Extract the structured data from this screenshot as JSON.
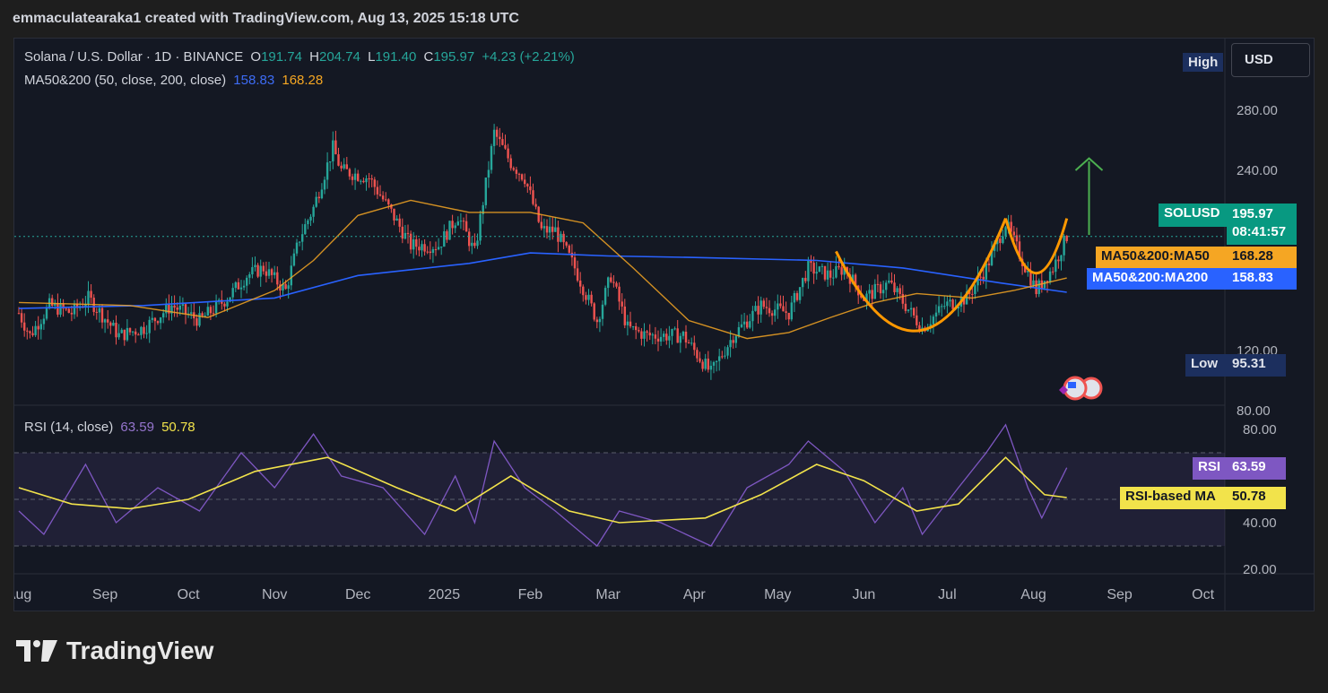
{
  "header": {
    "caption": "emmaculatearaka1 created with TradingView.com, Aug 13, 2025 15:18 UTC"
  },
  "legend": {
    "symbol": "Solana / U.S. Dollar · 1D · BINANCE",
    "o_label": "O",
    "o": "191.74",
    "h_label": "H",
    "h": "204.74",
    "l_label": "L",
    "l": "191.40",
    "c_label": "C",
    "c": "195.97",
    "change": "+4.23 (+2.21%)",
    "ma_label": "MA50&200 (50, close, 200, close)",
    "ma50": "158.83",
    "ma200": "168.28",
    "rsi_label": "RSI (14, close)",
    "rsi": "63.59",
    "rsi_ma": "50.78"
  },
  "badges": {
    "high_label": "High",
    "currency": "USD",
    "sym_label": "SOLUSD",
    "price": "195.97",
    "countdown": "08:41:57",
    "ma50_label": "MA50&200:MA50",
    "ma50_value": "168.28",
    "ma200_label": "MA50&200:MA200",
    "ma200_value": "158.83",
    "low_label": "Low",
    "low_value": "95.31",
    "rsi_label": "RSI",
    "rsi_value": "63.59",
    "rsima_label": "RSI-based MA",
    "rsima_value": "50.78"
  },
  "colors": {
    "up": "#26a69a",
    "down": "#ef5350",
    "ma50": "#f5a623",
    "ma200": "#2962ff",
    "rsi": "#7e57c2",
    "rsi_ma": "#f2e34b",
    "pattern": "#ff9800",
    "arrow": "#4caf50"
  },
  "chart_data": [
    {
      "type": "candlestick",
      "title": "Solana / U.S. Dollar · 1D · BINANCE",
      "x_ticks": [
        "Aug",
        "Sep",
        "Oct",
        "Nov",
        "Dec",
        "2025",
        "Feb",
        "Mar",
        "Apr",
        "May",
        "Jun",
        "Jul",
        "Aug",
        "Sep",
        "Oct"
      ],
      "y_ticks": [
        "80.00",
        "120.00",
        "240.00",
        "280.00"
      ],
      "ylim": [
        75,
        290
      ],
      "close_path": [
        [
          "2024-08-01",
          145
        ],
        [
          "2024-08-05",
          130
        ],
        [
          "2024-08-12",
          150
        ],
        [
          "2024-08-20",
          145
        ],
        [
          "2024-08-26",
          155
        ],
        [
          "2024-09-06",
          130
        ],
        [
          "2024-09-15",
          135
        ],
        [
          "2024-09-25",
          150
        ],
        [
          "2024-10-05",
          140
        ],
        [
          "2024-10-15",
          155
        ],
        [
          "2024-10-22",
          170
        ],
        [
          "2024-10-28",
          175
        ],
        [
          "2024-11-05",
          160
        ],
        [
          "2024-11-10",
          195
        ],
        [
          "2024-11-15",
          215
        ],
        [
          "2024-11-22",
          255
        ],
        [
          "2024-11-25",
          240
        ],
        [
          "2024-12-05",
          235
        ],
        [
          "2024-12-12",
          215
        ],
        [
          "2024-12-20",
          190
        ],
        [
          "2024-12-30",
          190
        ],
        [
          "2025-01-06",
          210
        ],
        [
          "2025-01-12",
          185
        ],
        [
          "2025-01-19",
          265
        ],
        [
          "2025-01-25",
          245
        ],
        [
          "2025-01-30",
          235
        ],
        [
          "2025-02-05",
          200
        ],
        [
          "2025-02-10",
          200
        ],
        [
          "2025-02-17",
          175
        ],
        [
          "2025-02-25",
          140
        ],
        [
          "2025-03-02",
          170
        ],
        [
          "2025-03-08",
          135
        ],
        [
          "2025-03-15",
          130
        ],
        [
          "2025-03-28",
          130
        ],
        [
          "2025-04-07",
          105
        ],
        [
          "2025-04-15",
          130
        ],
        [
          "2025-04-25",
          150
        ],
        [
          "2025-05-05",
          145
        ],
        [
          "2025-05-12",
          175
        ],
        [
          "2025-05-20",
          170
        ],
        [
          "2025-05-25",
          175
        ],
        [
          "2025-06-01",
          155
        ],
        [
          "2025-06-10",
          165
        ],
        [
          "2025-06-22",
          135
        ],
        [
          "2025-06-30",
          150
        ],
        [
          "2025-07-08",
          155
        ],
        [
          "2025-07-15",
          175
        ],
        [
          "2025-07-22",
          205
        ],
        [
          "2025-07-28",
          180
        ],
        [
          "2025-08-02",
          160
        ],
        [
          "2025-08-08",
          175
        ],
        [
          "2025-08-13",
          195.97
        ]
      ],
      "ma50_path": [
        [
          "2024-08-01",
          152
        ],
        [
          "2024-09-10",
          150
        ],
        [
          "2024-10-08",
          142
        ],
        [
          "2024-11-01",
          160
        ],
        [
          "2024-11-15",
          180
        ],
        [
          "2024-12-01",
          210
        ],
        [
          "2024-12-20",
          220
        ],
        [
          "2025-01-10",
          212
        ],
        [
          "2025-02-01",
          212
        ],
        [
          "2025-02-20",
          205
        ],
        [
          "2025-03-10",
          175
        ],
        [
          "2025-03-30",
          140
        ],
        [
          "2025-04-20",
          128
        ],
        [
          "2025-05-05",
          132
        ],
        [
          "2025-05-20",
          142
        ],
        [
          "2025-06-05",
          152
        ],
        [
          "2025-06-20",
          158
        ],
        [
          "2025-07-10",
          155
        ],
        [
          "2025-07-25",
          160
        ],
        [
          "2025-08-13",
          168.28
        ]
      ],
      "ma200_path": [
        [
          "2024-08-01",
          148
        ],
        [
          "2024-09-15",
          150
        ],
        [
          "2024-11-01",
          155
        ],
        [
          "2024-12-01",
          170
        ],
        [
          "2025-01-10",
          178
        ],
        [
          "2025-02-01",
          185
        ],
        [
          "2025-03-01",
          183
        ],
        [
          "2025-04-01",
          182
        ],
        [
          "2025-05-15",
          180
        ],
        [
          "2025-06-15",
          175
        ],
        [
          "2025-07-20",
          165
        ],
        [
          "2025-08-13",
          158.83
        ]
      ],
      "high": 204.74,
      "low": 95.31
    },
    {
      "type": "line",
      "title": "RSI (14, close)",
      "ylim": [
        20,
        85
      ],
      "y_ticks": [
        "20.00",
        "40.00",
        "80.00"
      ],
      "bands": [
        30,
        50,
        70
      ],
      "series": [
        {
          "name": "RSI",
          "values": [
            [
              "2024-08-01",
              45
            ],
            [
              "2024-08-10",
              35
            ],
            [
              "2024-08-25",
              65
            ],
            [
              "2024-09-05",
              40
            ],
            [
              "2024-09-20",
              55
            ],
            [
              "2024-10-05",
              45
            ],
            [
              "2024-10-20",
              70
            ],
            [
              "2024-11-01",
              55
            ],
            [
              "2024-11-15",
              78
            ],
            [
              "2024-11-25",
              60
            ],
            [
              "2024-12-10",
              55
            ],
            [
              "2024-12-25",
              35
            ],
            [
              "2025-01-05",
              60
            ],
            [
              "2025-01-12",
              40
            ],
            [
              "2025-01-19",
              75
            ],
            [
              "2025-01-30",
              55
            ],
            [
              "2025-02-10",
              45
            ],
            [
              "2025-02-25",
              30
            ],
            [
              "2025-03-05",
              45
            ],
            [
              "2025-03-20",
              40
            ],
            [
              "2025-04-07",
              30
            ],
            [
              "2025-04-20",
              55
            ],
            [
              "2025-05-05",
              65
            ],
            [
              "2025-05-12",
              75
            ],
            [
              "2025-05-25",
              62
            ],
            [
              "2025-06-05",
              40
            ],
            [
              "2025-06-15",
              55
            ],
            [
              "2025-06-22",
              35
            ],
            [
              "2025-07-05",
              55
            ],
            [
              "2025-07-15",
              70
            ],
            [
              "2025-07-22",
              82
            ],
            [
              "2025-07-30",
              55
            ],
            [
              "2025-08-04",
              42
            ],
            [
              "2025-08-13",
              63.59
            ]
          ]
        },
        {
          "name": "RSI-based MA",
          "values": [
            [
              "2024-08-01",
              55
            ],
            [
              "2024-08-20",
              48
            ],
            [
              "2024-09-10",
              46
            ],
            [
              "2024-10-01",
              50
            ],
            [
              "2024-10-25",
              62
            ],
            [
              "2024-11-20",
              68
            ],
            [
              "2024-12-15",
              55
            ],
            [
              "2025-01-05",
              45
            ],
            [
              "2025-01-25",
              60
            ],
            [
              "2025-02-15",
              45
            ],
            [
              "2025-03-05",
              40
            ],
            [
              "2025-04-05",
              42
            ],
            [
              "2025-04-25",
              52
            ],
            [
              "2025-05-15",
              65
            ],
            [
              "2025-06-01",
              58
            ],
            [
              "2025-06-20",
              45
            ],
            [
              "2025-07-05",
              48
            ],
            [
              "2025-07-22",
              68
            ],
            [
              "2025-08-05",
              52
            ],
            [
              "2025-08-13",
              50.78
            ]
          ]
        }
      ]
    }
  ]
}
